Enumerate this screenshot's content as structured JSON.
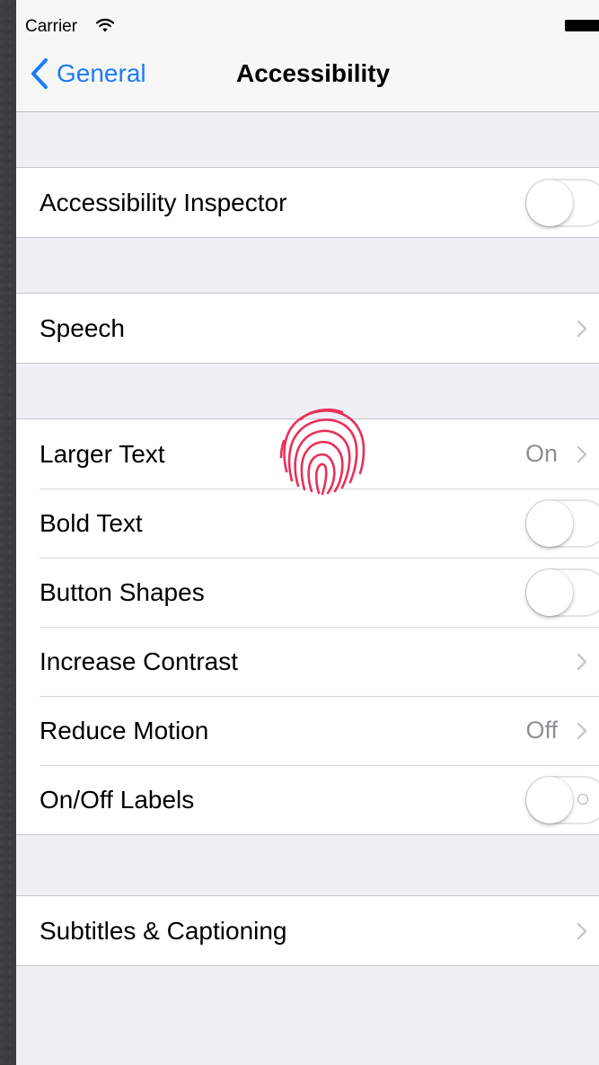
{
  "status_bar": {
    "carrier": "Carrier",
    "wifi_icon": "wifi-icon",
    "battery_icon": "battery-icon"
  },
  "nav_bar": {
    "back_label": "General",
    "title": "Accessibility"
  },
  "groups": {
    "inspector": {
      "label": "Accessibility Inspector",
      "toggle_on": false
    },
    "speech": {
      "label": "Speech"
    },
    "display": {
      "larger_text": {
        "label": "Larger Text",
        "value": "On"
      },
      "bold_text": {
        "label": "Bold Text",
        "toggle_on": false
      },
      "button_shapes": {
        "label": "Button Shapes",
        "toggle_on": false
      },
      "increase_contrast": {
        "label": "Increase Contrast"
      },
      "reduce_motion": {
        "label": "Reduce Motion",
        "value": "Off"
      },
      "on_off_labels": {
        "label": "On/Off Labels",
        "toggle_on": false
      }
    },
    "subtitles": {
      "label": "Subtitles & Captioning"
    }
  },
  "overlay": {
    "touch_indicator": "fingerprint-icon"
  },
  "colors": {
    "accent": "#1a7cf5",
    "background": "#efeff4",
    "secondary_text": "#8e8e93",
    "fingerprint": "#e8305a"
  }
}
